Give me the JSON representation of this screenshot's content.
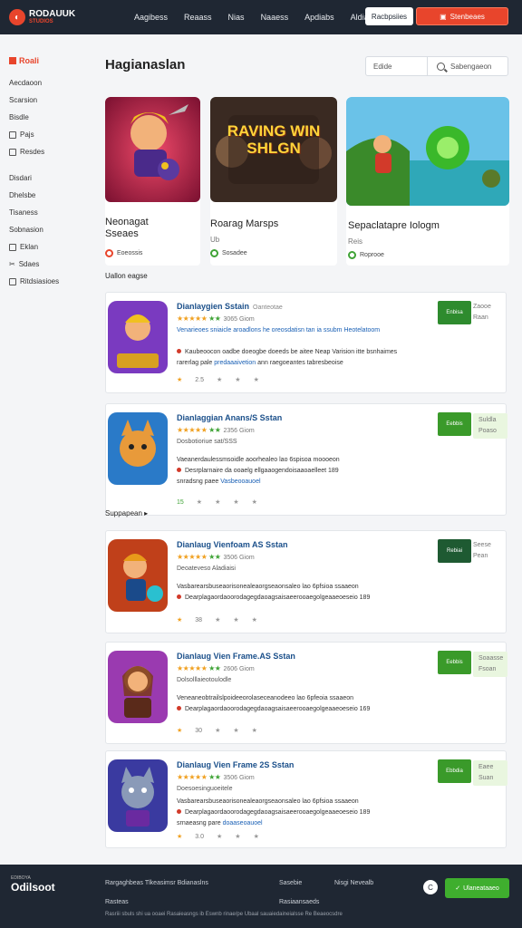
{
  "header": {
    "brand_name": "RODAUUK",
    "brand_tag": "STUDIOS",
    "nav": [
      "Aagibess",
      "Reaass",
      "Nias",
      "Naaess",
      "Apdiabs",
      "Aldia"
    ],
    "login_label": "Racbpsiies",
    "signup_label": "Stenbeaes"
  },
  "sidebar": {
    "heading": "Roali",
    "items_top": [
      "Aecdaoon",
      "Scarsion",
      "Bisdle",
      "Pajs",
      "Resdes"
    ],
    "items_bottom": [
      "Disdari",
      "Dhelsbe",
      "Tisaness",
      "Sobnasion",
      "Eklan",
      "Sdaes",
      "Ritdsiasioes"
    ]
  },
  "main": {
    "title": "Hagianaslan",
    "filter_label": "Edide",
    "search_placeholder": "Sabengaeon",
    "featured": [
      {
        "title": "Neonagat",
        "subtitle": "Sseaes",
        "meta": "Eoeossis"
      },
      {
        "title": "Roarag Marsps",
        "subtitle": "Ub",
        "meta": "Sosadee",
        "art_text": "RAVING WIN SHLGN"
      },
      {
        "title": "Sepaclatapre Iologm",
        "subtitle": "Reis",
        "meta": "Roprooe"
      }
    ],
    "section1": "Uallon eagse",
    "section2": "Suppapean"
  },
  "list": [
    {
      "title": "Dianlaygien Sstain",
      "title_sm": "Oanteotae",
      "rating": "4.9",
      "rcount": "3065 Giom",
      "l1": "Venarieoes sniaicle aroadlons he oreosdatisn tan ia ssubm Heotelatoom",
      "l2a": "Kaubeoocon oadbe doeogbe doeeds be aitee",
      "l2b": "Neap Varision itte bsnhaimes",
      "l3": "rarerlag pale",
      "l3b": "predaaaivetion",
      "l3c": "ann raegoeantes tabresbeoise",
      "f": "2.5",
      "act": "Enbisa",
      "side": [
        "Zaooe",
        "Raan"
      ],
      "color": "#2e8b2e",
      "side_green": false
    },
    {
      "title": "Dianlaggian Anans/S Sstan",
      "title_sm": "",
      "rating": "38",
      "rcount": "2356 Giom",
      "l1": "Dosbotioriue sat/SSS",
      "l2a": "Vaeanerdaulessmsoidle aoorhealeo lao 6spisoa",
      "l2b": "moooeon",
      "l3": "Desrplarnaire da ooaelg ellgaaogendoisaaoaelleet 189",
      "l3b": "",
      "l3c": "",
      "l4a": "snradsng paee",
      "l4b": "Vasbeooauoel",
      "f": "15",
      "act": "Eebbis",
      "side": [
        "Suldla",
        "Poaso"
      ],
      "color": "#3a9a2a",
      "side_green": true
    },
    {
      "title": "Dianlaug Vienfoam AS Sstan",
      "title_sm": "",
      "rating": "3.0",
      "rcount": "3506 Giom",
      "l1": "Deoateveso Aladiaisi",
      "l2a": "Vasbarearsbuseaorisonealeaorgseaonsaleo lao 6pfsioa",
      "l2b": "ssaaeon",
      "l3": "Dearplagaordaoorodagegdaoagsaisaeerooaegolgeaaeoeseio 189",
      "l3b": "",
      "l3c": "",
      "l4a": "",
      "l4b": "",
      "f": "38",
      "act": "Rebiai",
      "side": [
        "Seese",
        "Pean"
      ],
      "color": "#1e5a32",
      "side_green": false
    },
    {
      "title": "Dianlaug Vien Frame.AS Sstan",
      "title_sm": "",
      "rating": "30",
      "rcount": "2606 Giom",
      "l1": "Dolsolllaieotoulodle",
      "l2a": "Veneaneobtrailslpoideeorolaseceanodeeo lao 6pfeoia",
      "l2b": "ssaaeon",
      "l3": "Dearplagaordaoorodagegdaoagsaisaeerooaegolgeaaeoeseio 169",
      "l3b": "",
      "l3c": "",
      "l4a": "",
      "l4b": "",
      "f": "30",
      "act": "Eebbis",
      "side": [
        "Soaasse",
        "Fsoan"
      ],
      "color": "#3a9a2a",
      "side_green": true
    },
    {
      "title": "Dianlaug Vien Frame 2S Sstan",
      "title_sm": "",
      "rating": "30",
      "rcount": "3506 Giom",
      "l1": "Doesoesinguoeitele",
      "l2a": "Vasbarearsbuseaorisonealeaorgseaonsaleo lao 6pfsioa",
      "l2b": "ssaaeon",
      "l3": "Dearplagaordaoorodagegdaoagsaisaeerooaegolgeaaeoeseio 189",
      "l3b": "",
      "l3c": "",
      "l4a": "srnaeasng pare",
      "l4b": "doaaseoauoel",
      "f": "3.0",
      "act": "Ebbdia",
      "side": [
        "Eaee",
        "Suan"
      ],
      "color": "#3a9a2a",
      "side_green": true
    }
  ],
  "footer": {
    "brand_small": "EDIBOYA",
    "brand": "Odilsoot",
    "col1": [
      "Rargaghbeas Tlkeasimsr Bdianaslns",
      "Rasteas"
    ],
    "col2": [
      "Sasebie",
      "Rasiaansaeds"
    ],
    "col3": [
      "Nisgi Nevealb"
    ],
    "copyright": "Rasriii sbuls shi ua ooaei Rasaieasngs ib Eswnb rinae/pe Ubaal sauaiedaineialsse Re Beaeocsdre",
    "circle": "C",
    "cta": "Ulaneataaeo"
  }
}
